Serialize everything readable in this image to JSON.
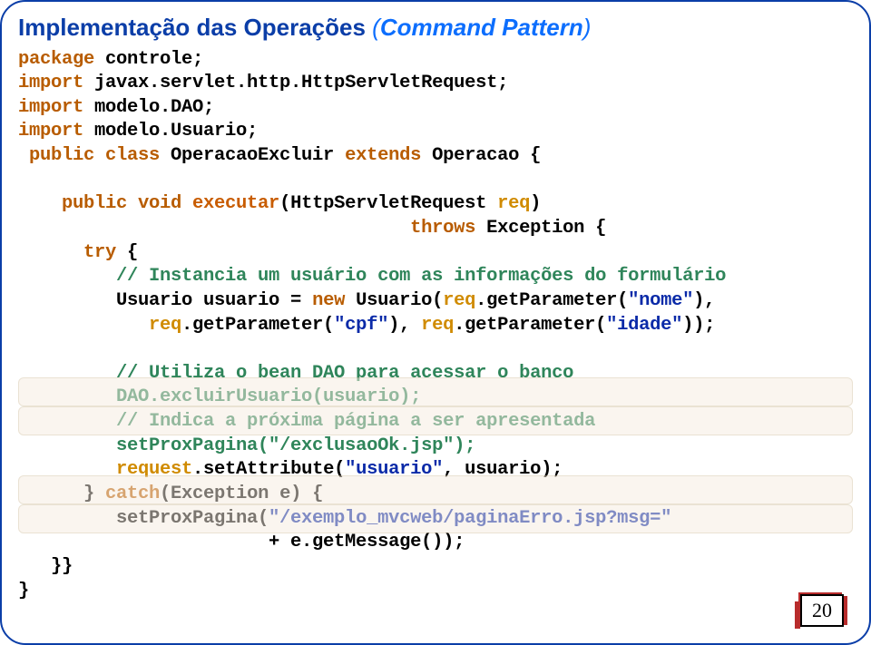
{
  "title": {
    "part1": "Implementação das Operações",
    "paren_open": " (",
    "part2": "Command Pattern",
    "paren_close": ")"
  },
  "code": {
    "l1a": "package",
    "l1b": " controle;",
    "l2a": "import",
    "l2b": " javax.servlet.http.HttpServletRequest;",
    "l3a": "import",
    "l3b": " modelo.DAO;",
    "l4a": "import",
    "l4b": " modelo.Usuario;",
    "l5a": " public class",
    "l5b": " OperacaoExcluir ",
    "l5c": "extends",
    "l5d": " Operacao {",
    "l6a": "    public void ",
    "l6b": "executar",
    "l6c": "(HttpServletRequest ",
    "l6d": "req",
    "l6e": ")",
    "l7a": "throws",
    "l7b": " Exception {",
    "l8a": "      try",
    "l8b": " {",
    "l9": "         // Instancia um usuário com as informações do formulário",
    "l10a": "         Usuario usuario = ",
    "l10b": "new",
    "l10c": " Usuario(",
    "l10d": "req",
    "l10e": ".getParameter(",
    "l10f": "\"nome\"",
    "l10g": "),",
    "l11a": "            req",
    "l11b": ".getParameter(",
    "l11c": "\"cpf\"",
    "l11d": "), ",
    "l11e": "req",
    "l11f": ".getParameter(",
    "l11g": "\"idade\"",
    "l11h": "));",
    "l12": "         // Utiliza o bean DAO para acessar o banco",
    "l13": "         DAO.excluirUsuario(usuario);",
    "l14": "         // Indica a próxima página a ser apresentada",
    "l15a": "         setProxPagina(",
    "l15b": "\"/exclusaoOk.jsp\"",
    "l15c": ");",
    "l16a": "         request",
    "l16b": ".setAttribute(",
    "l16c": "\"usuario\"",
    "l16d": ", usuario);",
    "l17a": "      } ",
    "l17b": "catch",
    "l17c": "(Exception e) {",
    "l18a": "         setProxPagina(",
    "l18b": "\"/exemplo_mvcweb/paginaErro.jsp?msg=\"",
    "l19": "                       + e.getMessage());",
    "l20": "   }}",
    "l21": "}"
  },
  "page_number": "20"
}
